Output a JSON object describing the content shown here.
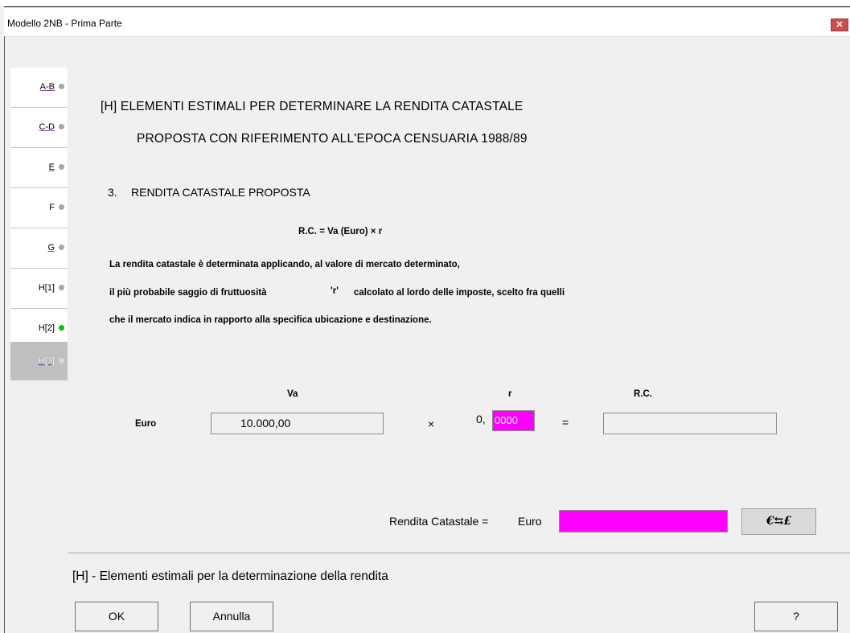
{
  "window": {
    "title": "Modello 2NB - Prima Parte",
    "close_label": "✕"
  },
  "tabs": [
    {
      "label": "A-B",
      "status": "gray"
    },
    {
      "label": "C-D",
      "status": "gray"
    },
    {
      "label": "E",
      "status": "gray"
    },
    {
      "label": "F",
      "status": "gray"
    },
    {
      "label": "G",
      "status": "gray"
    },
    {
      "label": "H[1]",
      "status": "gray"
    },
    {
      "label": "H[2]",
      "status": "green"
    },
    {
      "label": "H[3]",
      "status": "active"
    }
  ],
  "heading": {
    "line1": "[H]  ELEMENTI ESTIMALI PER DETERMINARE LA RENDITA CATASTALE",
    "line2": "PROPOSTA CON RIFERIMENTO ALL'EPOCA CENSUARIA 1988/89"
  },
  "section": {
    "number": "3.",
    "title": "RENDITA CATASTALE PROPOSTA"
  },
  "formula": "R.C. = Va (Euro)  ×  r",
  "description": {
    "line1": "La rendita catastale è determinata applicando, al valore di mercato determinato,",
    "line2_pre": "il più probabile saggio di fruttuosità",
    "line2_r": "'r'",
    "line2_post": "calcolato al lordo delle imposte,   scelto fra quelli",
    "line3": "che il mercato indica in rapporto alla specifica ubicazione e destinazione."
  },
  "calc": {
    "currency_label": "Euro",
    "va_header": "Va",
    "r_header": "r",
    "rc_header": "R.C.",
    "va_value": "10.000,00",
    "times": "×",
    "r_prefix": "0,",
    "r_value": "0000",
    "equals": "=",
    "rc_value": ""
  },
  "result": {
    "label": "Rendita Catastale =",
    "currency": "Euro",
    "value": "",
    "convert_label": "€⇆£"
  },
  "footer": {
    "title": "[H] - Elementi estimali per la determinazione della rendita",
    "ok": "OK",
    "cancel": "Annulla",
    "help": "?"
  },
  "colors": {
    "highlight": "#ff00ff",
    "status_green": "#00c800"
  }
}
